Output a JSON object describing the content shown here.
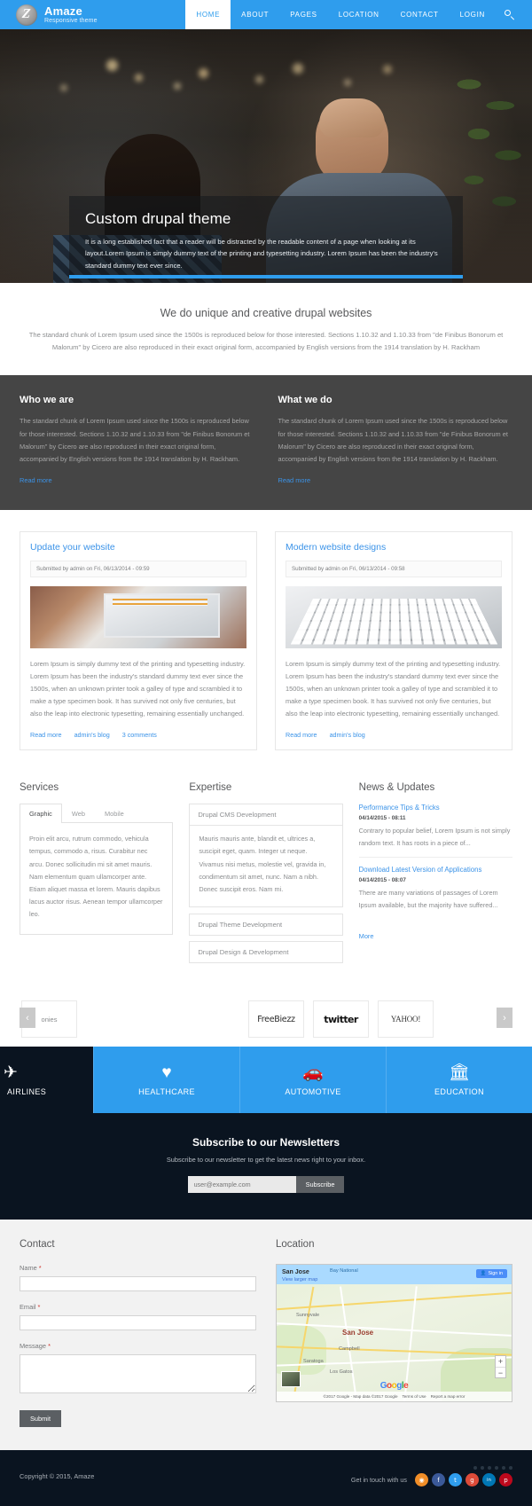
{
  "header": {
    "brand_name": "Amaze",
    "brand_sub": "Responsive theme",
    "logo_glyph": "Z",
    "nav": [
      {
        "label": "HOME",
        "active": true
      },
      {
        "label": "ABOUT",
        "active": false
      },
      {
        "label": "PAGES",
        "active": false
      },
      {
        "label": "LOCATION",
        "active": false
      },
      {
        "label": "CONTACT",
        "active": false
      },
      {
        "label": "LOGIN",
        "active": false
      }
    ],
    "search_icon": "search-icon"
  },
  "hero": {
    "title": "Custom drupal theme",
    "description": "It is a long established fact that a reader will be distracted by the readable content of a page when looking at its layout.Lorem Ipsum is simply dummy text of the printing and typesetting industry. Lorem Ipsum has been the industry's standard dummy text ever since."
  },
  "intro": {
    "heading": "We do unique and creative drupal websites",
    "paragraph": "The standard chunk of Lorem Ipsum used since the 1500s is reproduced below for those interested. Sections 1.10.32 and 1.10.33 from \"de Finibus Bonorum et Malorum\" by Cicero are also reproduced in their exact original form, accompanied by English versions from the 1914 translation by H. Rackham"
  },
  "dark_band": {
    "columns": [
      {
        "heading": "Who we are",
        "text": "The standard chunk of Lorem Ipsum used since the 1500s is reproduced below for those interested. Sections 1.10.32 and 1.10.33 from \"de Finibus Bonorum et Malorum\" by Cicero are also reproduced in their exact original form, accompanied by English versions from the 1914 translation by H. Rackham.",
        "link": "Read more"
      },
      {
        "heading": "What we do",
        "text": "The standard chunk of Lorem Ipsum used since the 1500s is reproduced below for those interested. Sections 1.10.32 and 1.10.33 from \"de Finibus Bonorum et Malorum\" by Cicero are also reproduced in their exact original form, accompanied by English versions from the 1914 translation by H. Rackham.",
        "link": "Read more"
      }
    ]
  },
  "blog": {
    "posts": [
      {
        "title": "Update your website",
        "meta": "Submitted by admin on Fri, 06/13/2014 - 09:59",
        "body": "Lorem Ipsum is simply dummy text of the printing and typesetting industry. Lorem Ipsum has been the industry's standard dummy text ever since the 1500s, when an unknown printer took a galley of type and scrambled it to make a type specimen book. It has survived not only five centuries, but also the leap into electronic typesetting, remaining essentially unchanged.",
        "link_read": "Read more",
        "link_blog": "admin's blog",
        "link_comments": "3 comments"
      },
      {
        "title": "Modern website designs",
        "meta": "Submitted by admin on Fri, 06/13/2014 - 09:58",
        "body": "Lorem Ipsum is simply dummy text of the printing and typesetting industry. Lorem Ipsum has been the industry's standard dummy text ever since the 1500s, when an unknown printer took a galley of type and scrambled it to make a type specimen book. It has survived not only five centuries, but also the leap into electronic typesetting, remaining essentially unchanged.",
        "link_read": "Read more",
        "link_blog": "admin's blog",
        "link_comments": ""
      }
    ]
  },
  "services": {
    "heading": "Services",
    "tabs": [
      {
        "label": "Graphic",
        "active": true
      },
      {
        "label": "Web",
        "active": false
      },
      {
        "label": "Mobile",
        "active": false
      }
    ],
    "panel_text": "Proin elit arcu, rutrum commodo, vehicula tempus, commodo a, risus. Curabitur nec arcu. Donec sollicitudin mi sit amet mauris. Nam elementum quam ullamcorper ante. Etiam aliquet massa et lorem. Mauris dapibus lacus auctor risus. Aenean tempor ullamcorper leo."
  },
  "expertise": {
    "heading": "Expertise",
    "items": [
      {
        "label": "Drupal CMS Development",
        "open": true,
        "body": "Mauris mauris ante, blandit et, ultrices a, suscipit eget, quam. Integer ut neque. Vivamus nisi metus, molestie vel, gravida in, condimentum sit amet, nunc. Nam a nibh. Donec suscipit eros. Nam mi."
      },
      {
        "label": "Drupal Theme Development",
        "open": false,
        "body": ""
      },
      {
        "label": "Drupal Design & Development",
        "open": false,
        "body": ""
      }
    ]
  },
  "news": {
    "heading": "News & Updates",
    "items": [
      {
        "title": "Performance Tips & Tricks",
        "date": "04/14/2015 - 08:11",
        "text": "Contrary to popular belief, Lorem Ipsum is not simply random text. It has roots in a piece of..."
      },
      {
        "title": "Download Latest Version of Applications",
        "date": "04/14/2015 - 08:07",
        "text": "There are many variations of passages of Lorem Ipsum available, but the majority have suffered..."
      }
    ],
    "more": "More"
  },
  "clients": {
    "prev_icon": "chevron-left-icon",
    "next_icon": "chevron-right-icon",
    "logos": [
      {
        "name": "ponies",
        "text": "onies"
      },
      {
        "name": "freebiezz",
        "text": "FreeBiezz"
      },
      {
        "name": "twitter",
        "text": "twitter"
      },
      {
        "name": "yahoo",
        "text": "YAHOO!"
      }
    ]
  },
  "icon_band": [
    {
      "label": "AIRLINES",
      "icon": "airplane-icon",
      "glyph": "✈",
      "style": "dark"
    },
    {
      "label": "HEALTHCARE",
      "icon": "heart-icon",
      "glyph": "♥",
      "style": "blue"
    },
    {
      "label": "AUTOMOTIVE",
      "icon": "car-icon",
      "glyph": "🚗",
      "style": "blue"
    },
    {
      "label": "EDUCATION",
      "icon": "bank-icon",
      "glyph": "🏛",
      "style": "blue"
    }
  ],
  "newsletter": {
    "heading": "Subscribe to our Newsletters",
    "subheading": "Subscribe to our newsletter to get the latest news right to your inbox.",
    "placeholder": "user@example.com",
    "button": "Subscribe"
  },
  "contact": {
    "heading": "Contact",
    "fields": [
      {
        "label": "Name",
        "required": true,
        "value": ""
      },
      {
        "label": "Email",
        "required": true,
        "value": ""
      },
      {
        "label": "Message",
        "required": true,
        "value": ""
      }
    ],
    "submit": "Submit"
  },
  "location": {
    "heading": "Location",
    "map": {
      "place": "San Jose",
      "larger_map_link": "View larger map",
      "signin": "Sign in",
      "city_label": "San Jose",
      "top_label": "Bay National",
      "labels": [
        "Sunnyvale",
        "Campbell",
        "Saratoga",
        "Los Gatos"
      ],
      "zoom_in": "+",
      "zoom_out": "−",
      "attribution": "©2017 Google - Map data ©2017 Google",
      "terms": "Terms of Use",
      "report": "Report a map error",
      "logo_letters": [
        "G",
        "o",
        "o",
        "g",
        "l",
        "e"
      ]
    }
  },
  "footer": {
    "copyright": "Copyright © 2015, Amaze",
    "get_in_touch": "Get in touch with us",
    "socials": [
      {
        "name": "rss",
        "glyph": "◉",
        "color": "#f18e28"
      },
      {
        "name": "facebook",
        "glyph": "f",
        "color": "#3b5998"
      },
      {
        "name": "twitter",
        "glyph": "t",
        "color": "#2f9ded"
      },
      {
        "name": "google-plus",
        "glyph": "g",
        "color": "#dd4b39"
      },
      {
        "name": "linkedin",
        "glyph": "in",
        "color": "#0077b5"
      },
      {
        "name": "pinterest",
        "glyph": "p",
        "color": "#bd081c"
      }
    ]
  },
  "colors": {
    "accent": "#2f9ded",
    "link": "#3b93e8",
    "dark": "#454545",
    "darkest": "#0a1420"
  }
}
